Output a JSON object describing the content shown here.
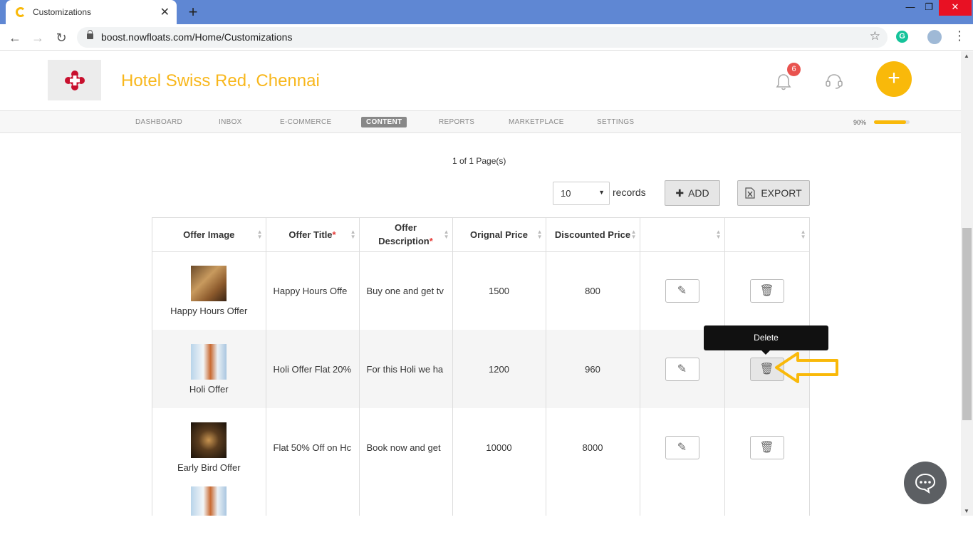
{
  "browser": {
    "tab_title": "Customizations",
    "tab_close": "✕",
    "new_tab": "+",
    "url": "boost.nowfloats.com/Home/Customizations",
    "minimize": "—",
    "restore": "❐",
    "close": "✕"
  },
  "header": {
    "business_name": "Hotel Swiss Red, Chennai",
    "notification_count": "6",
    "add_button": "+"
  },
  "nav": {
    "items": [
      "DASHBOARD",
      "INBOX",
      "E-COMMERCE",
      "CONTENT",
      "REPORTS",
      "MARKETPLACE",
      "SETTINGS"
    ],
    "active": "CONTENT",
    "progress_text": "90%",
    "progress_value": 0.9
  },
  "toolbar": {
    "pager": "1 of 1 Page(s)",
    "records_value": "10",
    "records_label": "records",
    "add_label": "ADD",
    "export_label": "EXPORT"
  },
  "table": {
    "headers": {
      "image": "Offer Image",
      "title": "Offer Title",
      "description_1": "Offer",
      "description_2": "Description",
      "original": "Orignal Price",
      "discounted": "Discounted Price",
      "required_mark": "*"
    },
    "rows": [
      {
        "name": "Happy Hours Offer",
        "title": "Happy Hours Offe",
        "description": "Buy one and get tv",
        "original": "1500",
        "discounted": "800"
      },
      {
        "name": "Holi Offer",
        "title": "Holi Offer Flat 20%",
        "description": "For this Holi we ha",
        "original": "1200",
        "discounted": "960"
      },
      {
        "name": "Early Bird Offer",
        "title": "Flat 50% Off on Hc",
        "description": "Book now and get",
        "original": "10000",
        "discounted": "8000"
      }
    ]
  },
  "tooltip": {
    "text": "Delete"
  },
  "colors": {
    "brand": "#f8b71c",
    "accent": "#f9b90a",
    "badge": "#e9534f",
    "tab_bar": "#5f87d3"
  },
  "icons": [
    "lock-icon",
    "star-icon",
    "bell-icon",
    "headset-icon",
    "plus-icon",
    "edit-icon",
    "trash-icon",
    "excel-icon",
    "chat-icon"
  ]
}
